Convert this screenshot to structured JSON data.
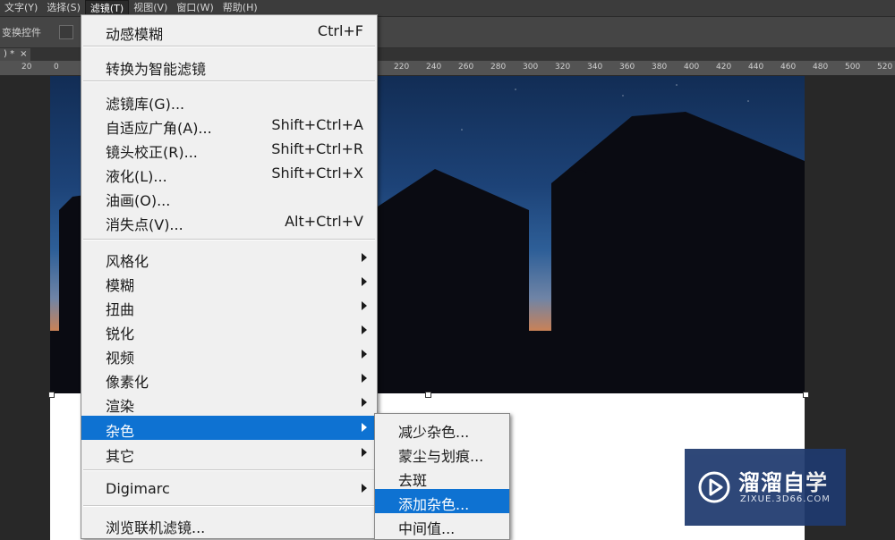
{
  "menubar": {
    "items": [
      "文字(Y)",
      "选择(S)",
      "滤镜(T)",
      "视图(V)",
      "窗口(W)",
      "帮助(H)"
    ],
    "active_index": 2
  },
  "options_bar": {
    "label": "变换控件"
  },
  "doc_tab": {
    "title": ") *",
    "close": "×"
  },
  "ruler": {
    "ticks": [
      "20",
      "0",
      "220",
      "240",
      "260",
      "280",
      "300",
      "320",
      "340",
      "360",
      "380",
      "400",
      "420",
      "440",
      "460",
      "480",
      "500",
      "520"
    ]
  },
  "filter_menu": {
    "last_filter": {
      "label": "动感模糊",
      "shortcut": "Ctrl+F"
    },
    "smart": {
      "label": "转换为智能滤镜"
    },
    "gallery": [
      {
        "label": "滤镜库(G)...",
        "shortcut": ""
      },
      {
        "label": "自适应广角(A)...",
        "shortcut": "Shift+Ctrl+A"
      },
      {
        "label": "镜头校正(R)...",
        "shortcut": "Shift+Ctrl+R"
      },
      {
        "label": "液化(L)...",
        "shortcut": "Shift+Ctrl+X"
      },
      {
        "label": "油画(O)...",
        "shortcut": ""
      },
      {
        "label": "消失点(V)...",
        "shortcut": "Alt+Ctrl+V"
      }
    ],
    "groups": [
      {
        "label": "风格化"
      },
      {
        "label": "模糊"
      },
      {
        "label": "扭曲"
      },
      {
        "label": "锐化"
      },
      {
        "label": "视频"
      },
      {
        "label": "像素化"
      },
      {
        "label": "渲染"
      },
      {
        "label": "杂色"
      },
      {
        "label": "其它"
      }
    ],
    "highlighted_group": "杂色",
    "digimarc": {
      "label": "Digimarc"
    },
    "browse": {
      "label": "浏览联机滤镜..."
    }
  },
  "noise_submenu": {
    "items": [
      "减少杂色...",
      "蒙尘与划痕...",
      "去斑",
      "添加杂色...",
      "中间值..."
    ],
    "highlighted_index": 3
  },
  "watermark": {
    "title": "溜溜自学",
    "subtitle": "ZIXUE.3D66.COM"
  },
  "colors": {
    "menu_bg": "#f0f0f0",
    "highlight": "#0e72d2",
    "app_bg": "#282828"
  }
}
